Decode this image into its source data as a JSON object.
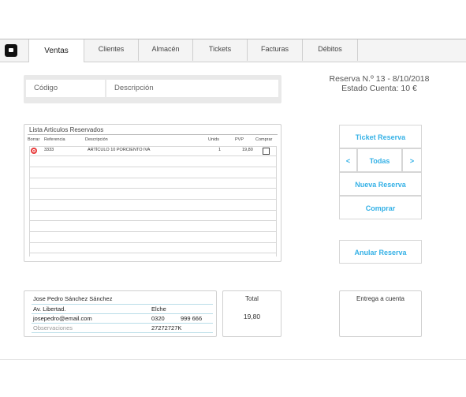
{
  "tabs": [
    {
      "label": "Ventas"
    },
    {
      "label": "Clientes"
    },
    {
      "label": "Almacén"
    },
    {
      "label": "Tickets"
    },
    {
      "label": "Facturas"
    },
    {
      "label": "Débitos"
    }
  ],
  "search": {
    "codigo_placeholder": "Código",
    "descripcion_placeholder": "Descripción"
  },
  "reserva": {
    "title": "Reserva N.º 13 - 8/10/2018",
    "estado": "Estado Cuenta: 10 €"
  },
  "table": {
    "title": "Lista Articulos Reservados",
    "headers": {
      "borrar": "Borrar",
      "referencia": "Referencia",
      "descripcion": "Descripción",
      "unids": "Unids",
      "pvp": "PVP",
      "comprar": "Comprar"
    },
    "rows": [
      {
        "referencia": "3333",
        "descripcion": "ARTÍCULO 10 PORCIENTO IVA",
        "unids": "1",
        "pvp": "19,80"
      }
    ]
  },
  "buttons": {
    "ticket_reserva": "Ticket Reserva",
    "prev": "<",
    "todas": "Todas",
    "next": ">",
    "nueva_reserva": "Nueva Reserva",
    "comprar": "Comprar",
    "anular_reserva": "Anular Reserva"
  },
  "customer": {
    "name": "Jose Pedro Sánchez Sánchez",
    "address": "Av. Libertad.",
    "city": "Elche",
    "email": "josepedro@email.com",
    "postal": "0320",
    "phone": "999 666",
    "observaciones": "Observaciones",
    "dni": "27272727K"
  },
  "total": {
    "label": "Total",
    "value": "19,80"
  },
  "entrega": {
    "label": "Entrega a cuenta"
  },
  "colors": {
    "accent": "#35b1e6",
    "delete": "#e83c3c"
  }
}
